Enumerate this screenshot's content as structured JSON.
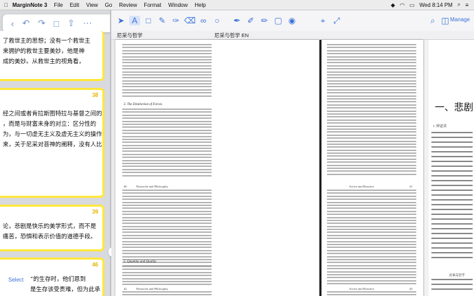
{
  "menubar": {
    "app_name": "MarginNote 3",
    "items": [
      "File",
      "Edit",
      "View",
      "Go",
      "Review",
      "Format",
      "Window",
      "Help"
    ],
    "clock": "Wed 8:14 PM"
  },
  "left_panel": {
    "cards": [
      {
        "number": "",
        "lines": [
          "了救世主的思想；没有一个救世主",
          "来拥护的救世主要美妙，他是神",
          "成的美妙。从救世主的视角看，"
        ]
      },
      {
        "number": "38",
        "lines": [
          "",
          "经之间或者肯拉斯图特拉与基督之间的",
          "，而是与财富未身的对立：区分性的",
          "为，与一切虚无主义及虚无主义的操作",
          "来，关于尼采对菩神的阐释，没有人比"
        ]
      },
      {
        "number": "39",
        "lines": [
          "",
          "论，悲剧是快乐的美学形式，而不是",
          "痛苦，恐惧和表示价值的道德手段。"
        ]
      },
      {
        "number": "46",
        "lines": [
          "",
          "”的生存时，他们恩到",
          "是生存该受责难，但为此承",
          "生存是要从无罪行为中解脱"
        ]
      }
    ],
    "select_label": "Select",
    "split_handle": "< >"
  },
  "toolbar": {
    "tools": [
      "text-tool",
      "box-tool",
      "pen-tool",
      "line-tool",
      "highlighter-tool",
      "eraser-tool",
      "lasso-tool",
      "sticky-tool"
    ],
    "manage_label": "Manage"
  },
  "tabs": {
    "left_doc": "尼采与哲学",
    "right_doc": "尼采与哲学 EN"
  },
  "pages": {
    "left_top_heading": "Nietzsche and Philosophy",
    "left_top_section_a": "3. The Distinction of Forces",
    "left_bottom_heading": "Nietzsche and Philosophy",
    "left_bottom_section": "5. Quantity and Quality",
    "right_top_heading": "Active and Reactive",
    "right_bottom_heading": "Active and Reactive",
    "left_top_page_no": "40",
    "right_top_page_no": "41",
    "left_bottom_page_no": "42",
    "right_bottom_page_no": "43"
  },
  "chinese_page": {
    "heading": "一、悲剧",
    "subheading": "1. 辩证法",
    "running_head": "尼采与哲学"
  }
}
